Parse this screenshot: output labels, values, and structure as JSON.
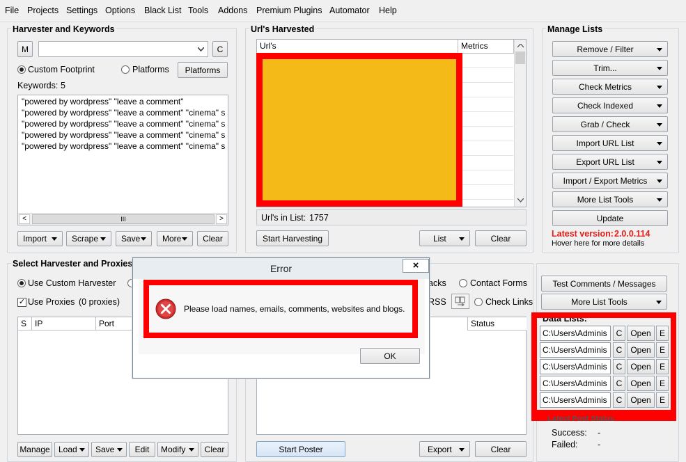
{
  "menu": [
    "File",
    "Projects",
    "Settings",
    "Options",
    "Black List",
    "Tools",
    "Addons",
    "Premium Plugins",
    "Automator",
    "Help"
  ],
  "harvester": {
    "title": "Harvester and Keywords",
    "m_button": "M",
    "c_button": "C",
    "dropdown_value": "",
    "radio_custom": "Custom Footprint",
    "radio_platforms": "Platforms",
    "platforms_button": "Platforms",
    "keywords_label": "Keywords:",
    "keywords_count": "5",
    "keywords": [
      "\"powered by wordpress\" \"leave a comment\"",
      "\"powered by wordpress\" \"leave a comment\" \"cinema\" s",
      "\"powered by wordpress\" \"leave a comment\" \"cinema\" s",
      "\"powered by wordpress\" \"leave a comment\" \"cinema\" s",
      "\"powered by wordpress\" \"leave a comment\" \"cinema\" s"
    ],
    "scroll_thumb": "III",
    "buttons": {
      "import": "Import",
      "scrape": "Scrape",
      "save": "Save",
      "more": "More",
      "clear": "Clear"
    }
  },
  "urls": {
    "title": "Url's Harvested",
    "col_urls": "Url's",
    "col_metrics": "Metrics",
    "in_list_label": "Url's in List:",
    "in_list_count": "1757",
    "start_button": "Start Harvesting",
    "list_button": "List",
    "clear_button": "Clear"
  },
  "manage": {
    "title": "Manage Lists",
    "buttons": [
      "Remove / Filter",
      "Trim...",
      "Check Metrics",
      "Check Indexed",
      "Grab / Check",
      "Import URL List",
      "Export URL List",
      "Import / Export Metrics",
      "More List Tools"
    ],
    "update_button": "Update",
    "latest_label": "Latest version:",
    "latest_value": "2.0.0.114",
    "hover_text": "Hover here for more details"
  },
  "proxies": {
    "title": "Select Harvester and Proxies",
    "radio_custom": "Use Custom Harvester",
    "use_proxies": "Use Proxies",
    "proxies_count": "(0 proxies)",
    "col_s": "S",
    "col_ip": "IP",
    "col_port": "Port",
    "buttons": {
      "manage": "Manage",
      "load": "Load",
      "save": "Save",
      "edit": "Edit",
      "modify": "Modify",
      "clear": "Clear"
    }
  },
  "poster": {
    "opt_backs": "acks",
    "opt_contact": "Contact Forms",
    "opt_rss": "RSS",
    "opt_check_links": "Check Links",
    "col_status": "Status",
    "start_button": "Start Poster",
    "export_button": "Export",
    "clear_button": "Clear"
  },
  "right_tools": {
    "test_button": "Test Comments / Messages",
    "more_tools": "More List Tools"
  },
  "data_lists": {
    "title": "Data Lists:",
    "paths": [
      "C:\\Users\\Adminis",
      "C:\\Users\\Adminis",
      "C:\\Users\\Adminis",
      "C:\\Users\\Adminis",
      "C:\\Users\\Adminis"
    ],
    "c_label": "C",
    "open_label": "Open",
    "e_label": "E"
  },
  "status": {
    "title": "Latest Post Status",
    "success_label": "Success:",
    "success_value": "-",
    "failed_label": "Failed:",
    "failed_value": "-"
  },
  "dialog": {
    "title": "Error",
    "close": "×",
    "message": "Please load names, emails, comments, websites and blogs.",
    "ok_button": "OK"
  },
  "colors": {
    "highlight_red": "#ff0000",
    "redacted_fill": "#f4ba18",
    "version_red": "#e0201a"
  }
}
